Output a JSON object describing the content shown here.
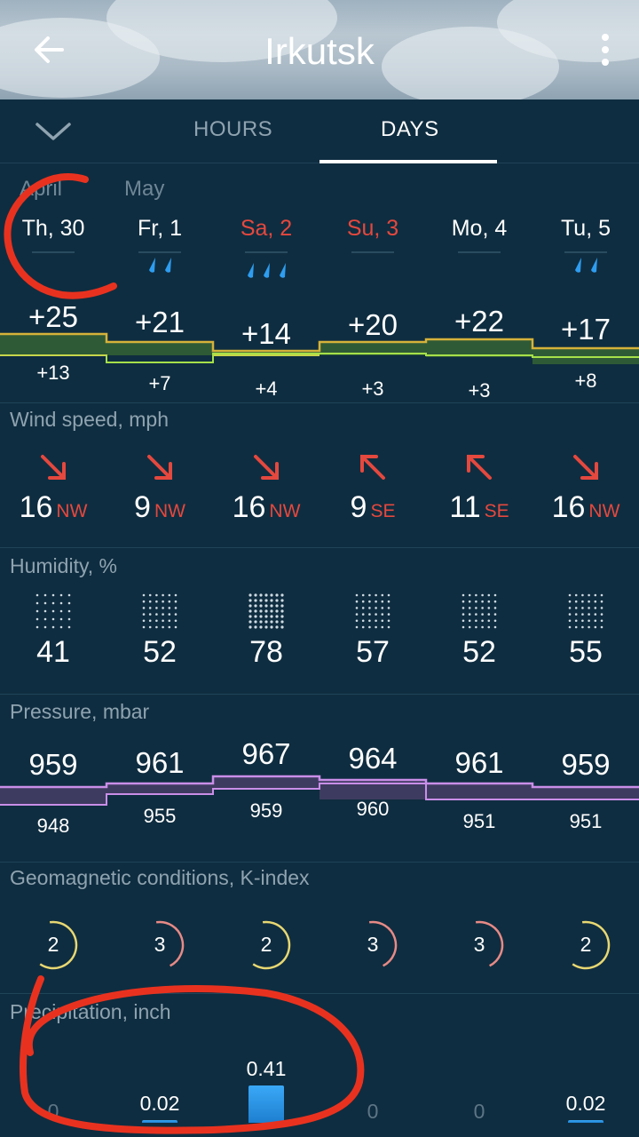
{
  "header": {
    "title": "Irkutsk",
    "back_icon": "arrow-left-icon",
    "menu_icon": "more-vertical-icon"
  },
  "tabs": {
    "collapse_icon": "chevron-down-icon",
    "items": [
      {
        "label": "HOURS",
        "active": false
      },
      {
        "label": "DAYS",
        "active": true
      }
    ]
  },
  "months": [
    "April",
    "May"
  ],
  "days": [
    {
      "label": "Th, 30",
      "weekend": false,
      "rain_drops": 0
    },
    {
      "label": "Fr, 1",
      "weekend": false,
      "rain_drops": 2
    },
    {
      "label": "Sa, 2",
      "weekend": true,
      "rain_drops": 3
    },
    {
      "label": "Su, 3",
      "weekend": true,
      "rain_drops": 0
    },
    {
      "label": "Mo, 4",
      "weekend": false,
      "rain_drops": 0
    },
    {
      "label": "Tu, 5",
      "weekend": false,
      "rain_drops": 2
    }
  ],
  "temperature": {
    "highs": [
      "+25",
      "+21",
      "+14",
      "+20",
      "+22",
      "+17"
    ],
    "lows": [
      "+13",
      "+7",
      "+4",
      "+3",
      "+3",
      "+8"
    ]
  },
  "wind": {
    "label": "Wind speed, mph",
    "speeds": [
      "16",
      "9",
      "16",
      "9",
      "11",
      "16"
    ],
    "directions": [
      "NW",
      "NW",
      "NW",
      "SE",
      "SE",
      "NW"
    ],
    "arrow_icons": [
      "arrow-down-right-icon",
      "arrow-down-right-icon",
      "arrow-down-right-icon",
      "arrow-up-left-icon",
      "arrow-up-left-icon",
      "arrow-down-right-icon"
    ]
  },
  "humidity": {
    "label": "Humidity, %",
    "values": [
      "41",
      "52",
      "78",
      "57",
      "52",
      "55"
    ]
  },
  "pressure": {
    "label": "Pressure, mbar",
    "highs": [
      "959",
      "961",
      "967",
      "964",
      "961",
      "959"
    ],
    "lows": [
      "948",
      "955",
      "959",
      "960",
      "951",
      "951"
    ]
  },
  "geomagnetic": {
    "label": "Geomagnetic conditions, K-index",
    "values": [
      "2",
      "3",
      "2",
      "3",
      "3",
      "2"
    ],
    "colors": {
      "low": "#e8d872",
      "mid": "#e88a86"
    }
  },
  "precipitation": {
    "label": "Precipitation, inch",
    "values": [
      "0",
      "0.02",
      "0.41",
      "0",
      "0",
      "0.02"
    ]
  },
  "colors": {
    "background": "#0f2d40",
    "weekend": "#e5483e",
    "temp_fill": "#2f5a36",
    "pressure_fill": "#3e3b60",
    "pressure_line": "#c98ee8",
    "rain": "#2e9df0",
    "annotation": "#e8321f"
  }
}
